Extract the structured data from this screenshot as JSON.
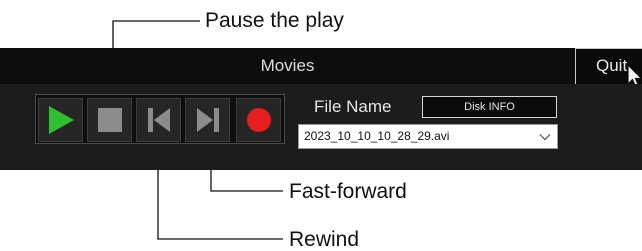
{
  "callouts": {
    "pause": "Pause the play",
    "fast_forward": "Fast-forward",
    "rewind": "Rewind"
  },
  "window": {
    "title": "Movies",
    "quit_label": "Quit"
  },
  "controls": {
    "buttons": [
      {
        "name": "play-button",
        "icon": "play-icon",
        "color": "#2fbf2f"
      },
      {
        "name": "stop-button",
        "icon": "stop-icon",
        "color": "#8c8c8c"
      },
      {
        "name": "rewind-button",
        "icon": "skip-back-icon",
        "color": "#8c8c8c"
      },
      {
        "name": "fast-forward-button",
        "icon": "skip-forward-icon",
        "color": "#8c8c8c"
      },
      {
        "name": "record-button",
        "icon": "record-icon",
        "color": "#e61e1e"
      }
    ]
  },
  "file": {
    "label": "File Name",
    "disk_info_label": "Disk INFO",
    "selected_file": "2023_10_10_10_28_29.avi"
  }
}
